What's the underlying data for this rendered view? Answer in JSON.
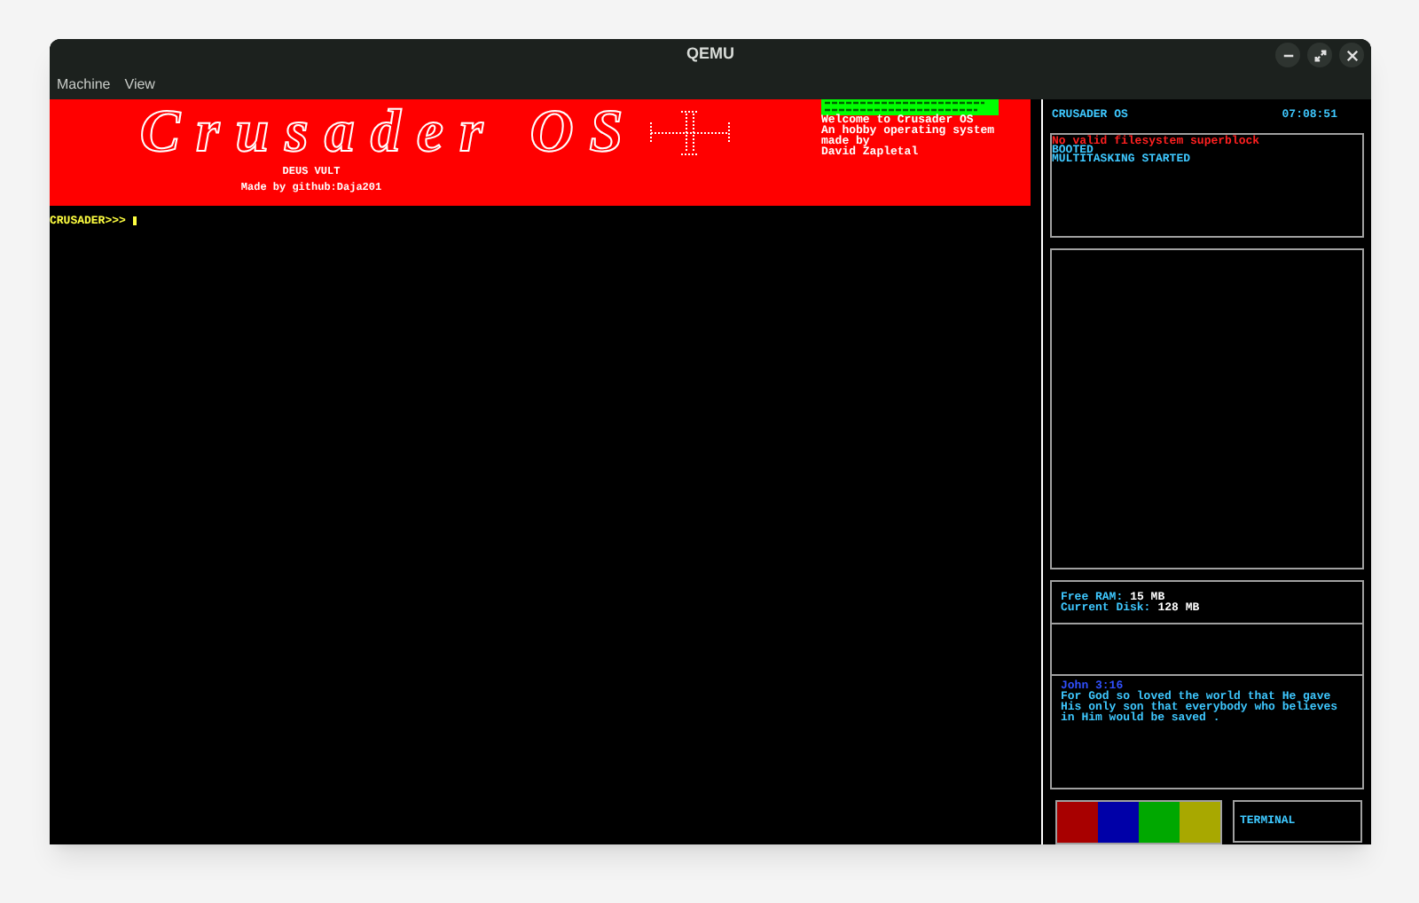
{
  "window": {
    "title": "QEMU"
  },
  "menu": [
    "Machine",
    "View"
  ],
  "banner": {
    "logo": "Crusader OS",
    "subtitle": "DEUS VULT",
    "credit": "Made by github:Daja201",
    "info": [
      "Welcome to Crusader OS",
      "An hobby operating system",
      "made by",
      "David Zapletal"
    ]
  },
  "terminal": {
    "prompt": "CRUSADER>>>"
  },
  "sidebar": {
    "title": "CRUSADER OS",
    "clock": "07:08:51",
    "log": [
      {
        "text": "No valid filesystem superblock",
        "kind": "error"
      },
      {
        "text": "BOOTED",
        "kind": "info"
      },
      {
        "text": "MULTITASKING STARTED",
        "kind": "info"
      }
    ],
    "stats": [
      {
        "label": "Free RAM:",
        "value": "15 MB"
      },
      {
        "label": "Current Disk:",
        "value": "128 MB"
      }
    ],
    "verse": {
      "reference": "John 3:16",
      "text": "For God so loved the world that He gave His only son that everybody who believes in Him would be saved ."
    },
    "swatches": [
      {
        "color": "#a80000"
      },
      {
        "color": "#0000a8"
      },
      {
        "color": "#00a800"
      },
      {
        "color": "#a8a800"
      }
    ],
    "button": "TERMINAL"
  }
}
